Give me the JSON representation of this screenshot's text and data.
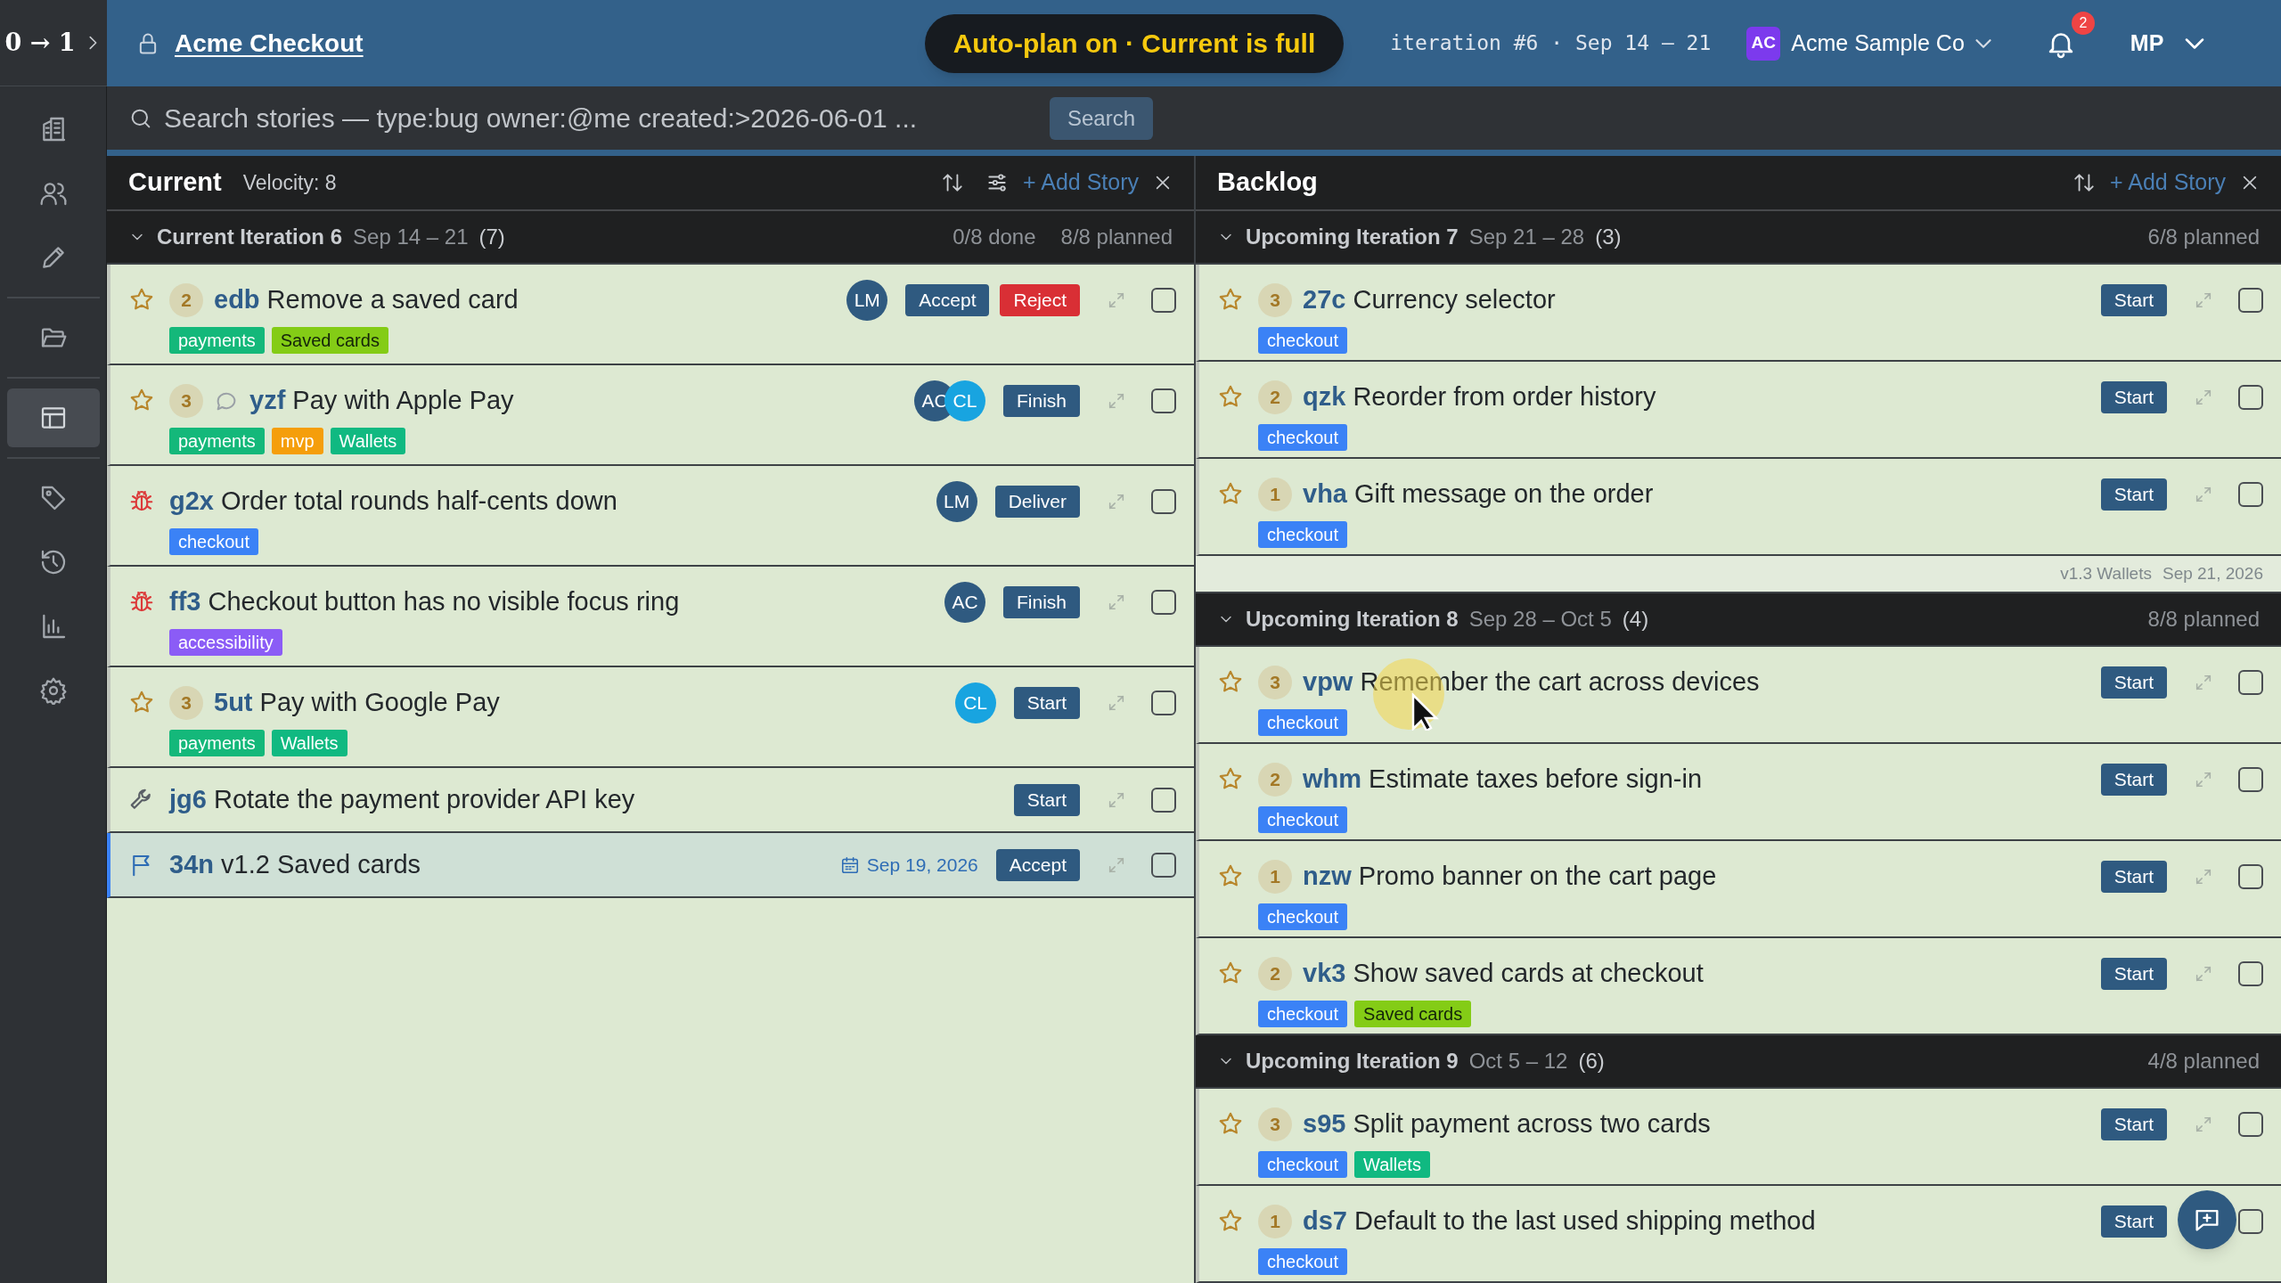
{
  "topbar": {
    "brand": "0 → 1",
    "project": "Acme Checkout",
    "banner": "Auto-plan on · Current is full",
    "iteration": "iteration #6 · Sep 14 – 21",
    "org": {
      "initials": "AC",
      "name": "Acme Sample Co"
    },
    "notifications": "2",
    "user": "MP"
  },
  "sidebar": {
    "groups": [
      [
        {
          "selected": false
        },
        {
          "selected": false
        },
        {
          "selected": false
        }
      ],
      [
        {
          "selected": false
        }
      ],
      [
        {
          "selected": true
        }
      ],
      [
        {
          "selected": false
        },
        {
          "selected": false
        },
        {
          "selected": false
        },
        {
          "selected": false
        }
      ]
    ]
  },
  "search": {
    "placeholder": "Search stories — type:bug owner:@me created:>2026-06-01 ...",
    "button": "Search"
  },
  "panels": [
    {
      "kind": "current",
      "title": "Current",
      "velocity": "Velocity: 8",
      "add": "+ Add Story",
      "sections": [
        {
          "kind": "iteration",
          "expanded": true,
          "title": "Current Iteration 6",
          "dates": "Sep 14 – 21",
          "count": "(7)",
          "done": "0/8 done",
          "planned": "8/8 planned",
          "stories": [
            {
              "kind": "feature",
              "estimate": "2",
              "comments": false,
              "checked": false,
              "id": "edb",
              "title": "Remove a saved card",
              "tags": [
                {
                  "label": "payments",
                  "color": "#14b87a"
                },
                {
                  "label": "Saved cards",
                  "color": "#84cc16"
                }
              ],
              "owners": [
                {
                  "initials": "LM",
                  "color": "#2f5a80"
                }
              ],
              "actions": [
                {
                  "label": "Accept",
                  "kind": "primary"
                },
                {
                  "label": "Reject",
                  "kind": "danger"
                }
              ]
            },
            {
              "kind": "feature",
              "estimate": "3",
              "comments": true,
              "checked": false,
              "id": "yzf",
              "title": "Pay with Apple Pay",
              "tags": [
                {
                  "label": "payments",
                  "color": "#14b87a"
                },
                {
                  "label": "mvp",
                  "color": "#f59e0b"
                },
                {
                  "label": "Wallets",
                  "color": "#10b981"
                }
              ],
              "owners": [
                {
                  "initials": "AC",
                  "color": "#2f5a80"
                },
                {
                  "initials": "CL",
                  "color": "#18a4e0"
                }
              ],
              "actions": [
                {
                  "label": "Finish",
                  "kind": "primary"
                }
              ]
            },
            {
              "kind": "bug",
              "comments": false,
              "checked": false,
              "id": "g2x",
              "title": "Order total rounds half-cents down",
              "tags": [
                {
                  "label": "checkout",
                  "color": "#3b82f6"
                }
              ],
              "owners": [
                {
                  "initials": "LM",
                  "color": "#2f5a80"
                }
              ],
              "actions": [
                {
                  "label": "Deliver",
                  "kind": "primary"
                }
              ]
            },
            {
              "kind": "bug",
              "comments": false,
              "checked": false,
              "id": "ff3",
              "title": "Checkout button has no visible focus ring",
              "tags": [
                {
                  "label": "accessibility",
                  "color": "#8b5cf6"
                }
              ],
              "owners": [
                {
                  "initials": "AC",
                  "color": "#2f5a80"
                }
              ],
              "actions": [
                {
                  "label": "Finish",
                  "kind": "primary"
                }
              ]
            },
            {
              "kind": "feature",
              "estimate": "3",
              "comments": false,
              "checked": false,
              "id": "5ut",
              "title": "Pay with Google Pay",
              "tags": [
                {
                  "label": "payments",
                  "color": "#14b87a"
                },
                {
                  "label": "Wallets",
                  "color": "#10b981"
                }
              ],
              "owners": [
                {
                  "initials": "CL",
                  "color": "#18a4e0"
                }
              ],
              "actions": [
                {
                  "label": "Start",
                  "kind": "primary"
                }
              ]
            },
            {
              "kind": "chore",
              "comments": false,
              "checked": false,
              "id": "jg6",
              "title": "Rotate the payment provider API key",
              "actions": [
                {
                  "label": "Start",
                  "kind": "primary"
                }
              ]
            },
            {
              "kind": "release",
              "comments": false,
              "checked": false,
              "id": "34n",
              "title": "v1.2 Saved cards",
              "date": "Sep 19, 2026",
              "actions": [
                {
                  "label": "Accept",
                  "kind": "primary"
                }
              ]
            }
          ]
        }
      ]
    },
    {
      "kind": "backlog",
      "title": "Backlog",
      "add": "+ Add Story",
      "sections": [
        {
          "kind": "iteration",
          "expanded": true,
          "title": "Upcoming Iteration 7",
          "dates": "Sep 21 – 28",
          "count": "(3)",
          "planned": "6/8 planned",
          "stories": [
            {
              "kind": "feature",
              "estimate": "3",
              "comments": false,
              "checked": false,
              "id": "27c",
              "title": "Currency selector",
              "tags": [
                {
                  "label": "checkout",
                  "color": "#3b82f6"
                }
              ],
              "actions": [
                {
                  "label": "Start",
                  "kind": "primary"
                }
              ]
            },
            {
              "kind": "feature",
              "estimate": "2",
              "comments": false,
              "checked": false,
              "id": "qzk",
              "title": "Reorder from order history",
              "tags": [
                {
                  "label": "checkout",
                  "color": "#3b82f6"
                }
              ],
              "actions": [
                {
                  "label": "Start",
                  "kind": "primary"
                }
              ]
            },
            {
              "kind": "feature",
              "estimate": "1",
              "comments": false,
              "checked": false,
              "id": "vha",
              "title": "Gift message on the order",
              "tags": [
                {
                  "label": "checkout",
                  "color": "#3b82f6"
                }
              ],
              "actions": [
                {
                  "label": "Start",
                  "kind": "primary"
                }
              ]
            }
          ]
        },
        {
          "kind": "release",
          "title": "v1.3 Wallets",
          "date": "Sep 21, 2026"
        },
        {
          "kind": "iteration",
          "expanded": true,
          "title": "Upcoming Iteration 8",
          "dates": "Sep 28 – Oct 5",
          "count": "(4)",
          "planned": "8/8 planned",
          "stories": [
            {
              "kind": "feature",
              "estimate": "3",
              "comments": false,
              "checked": false,
              "id": "vpw",
              "title": "Remember the cart across devices",
              "tags": [
                {
                  "label": "checkout",
                  "color": "#3b82f6"
                }
              ],
              "actions": [
                {
                  "label": "Start",
                  "kind": "primary"
                }
              ]
            },
            {
              "kind": "feature",
              "estimate": "2",
              "comments": false,
              "checked": false,
              "id": "whm",
              "title": "Estimate taxes before sign-in",
              "tags": [
                {
                  "label": "checkout",
                  "color": "#3b82f6"
                }
              ],
              "actions": [
                {
                  "label": "Start",
                  "kind": "primary"
                }
              ]
            },
            {
              "kind": "feature",
              "estimate": "1",
              "comments": false,
              "checked": false,
              "id": "nzw",
              "title": "Promo banner on the cart page",
              "tags": [
                {
                  "label": "checkout",
                  "color": "#3b82f6"
                }
              ],
              "actions": [
                {
                  "label": "Start",
                  "kind": "primary"
                }
              ]
            },
            {
              "kind": "feature",
              "estimate": "2",
              "comments": false,
              "checked": false,
              "id": "vk3",
              "title": "Show saved cards at checkout",
              "tags": [
                {
                  "label": "checkout",
                  "color": "#3b82f6"
                },
                {
                  "label": "Saved cards",
                  "color": "#84cc16"
                }
              ],
              "actions": [
                {
                  "label": "Start",
                  "kind": "primary"
                }
              ]
            }
          ]
        },
        {
          "kind": "iteration",
          "expanded": true,
          "title": "Upcoming Iteration 9",
          "dates": "Oct 5 – 12",
          "count": "(6)",
          "planned": "4/8 planned",
          "stories": [
            {
              "kind": "feature",
              "estimate": "3",
              "comments": false,
              "checked": false,
              "id": "s95",
              "title": "Split payment across two cards",
              "tags": [
                {
                  "label": "checkout",
                  "color": "#3b82f6"
                },
                {
                  "label": "Wallets",
                  "color": "#10b981"
                }
              ],
              "actions": [
                {
                  "label": "Start",
                  "kind": "primary"
                }
              ]
            },
            {
              "kind": "feature",
              "estimate": "1",
              "comments": false,
              "checked": false,
              "id": "ds7",
              "title": "Default to the last used shipping method",
              "tags": [
                {
                  "label": "checkout",
                  "color": "#3b82f6"
                }
              ],
              "actions": [
                {
                  "label": "Start",
                  "kind": "primary"
                }
              ]
            }
          ]
        }
      ]
    }
  ]
}
